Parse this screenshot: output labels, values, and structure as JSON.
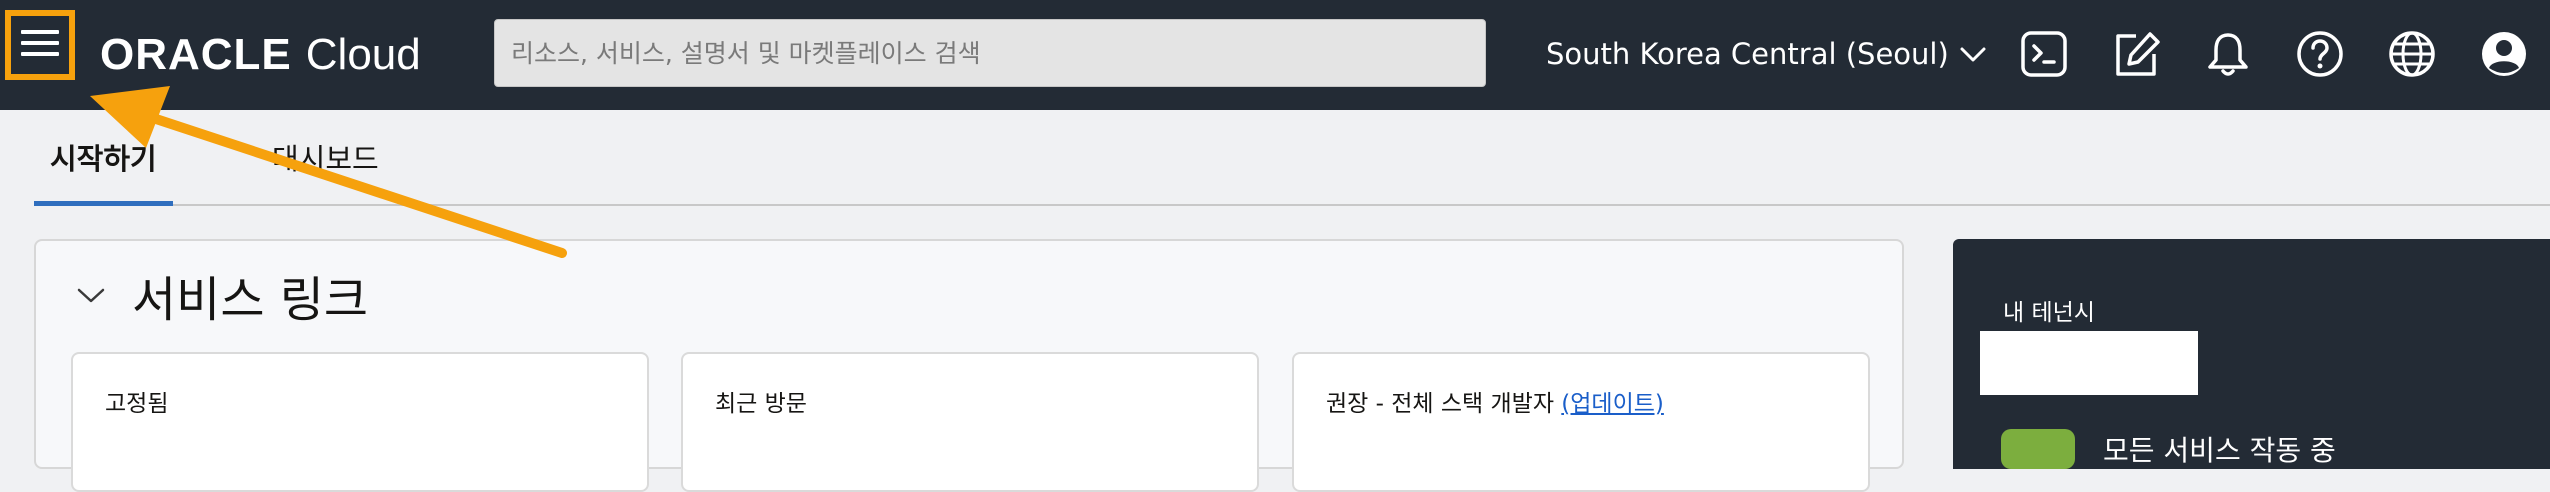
{
  "header": {
    "logo": {
      "brand": "ORACLE",
      "product": "Cloud"
    },
    "search": {
      "placeholder": "리소스, 서비스, 설명서 및 마켓플레이스 검색"
    },
    "region": "South Korea Central (Seoul)",
    "icons": [
      "menu-icon",
      "cloud-shell-icon",
      "edit-icon",
      "bell-icon",
      "help-icon",
      "globe-icon",
      "profile-icon",
      "chevron-down-icon"
    ]
  },
  "tabs": [
    {
      "label": "시작하기",
      "active": true
    },
    {
      "label": "대시보드",
      "active": false
    }
  ],
  "service_links": {
    "title": "서비스 링크",
    "cards": [
      {
        "label": "고정됨"
      },
      {
        "label": "최근 방문"
      },
      {
        "label": "권장 - 전체 스택 개발자",
        "link": "(업데이트)"
      }
    ]
  },
  "tenancy": {
    "title": "내 테넌시",
    "status": "모든 서비스 작동 중"
  },
  "colors": {
    "topbar": "#232b35",
    "highlight": "#f6a10d",
    "tab_underline": "#2f6ebe",
    "link": "#1a5ec9",
    "status_ok": "#7cae3e"
  }
}
